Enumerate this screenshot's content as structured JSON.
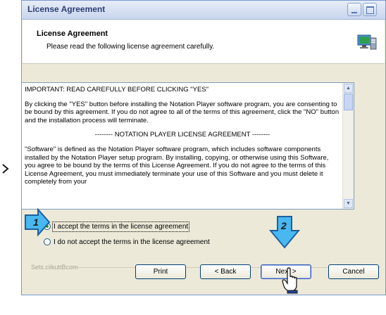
{
  "window": {
    "title": "License Agreement",
    "header_title": "License Agreement",
    "header_subtitle": "Please read the following license agreement carefully."
  },
  "license": {
    "paragraphs": [
      "IMPORTANT: READ CAREFULLY BEFORE CLICKING \"YES\"",
      "By clicking the \"YES\" button before installing the Notation Player software program, you are consenting to be bound by this agreement. If you do not agree to all of the terms of this agreement, click the \"NO\" button and the installation process will terminate.",
      "-------- NOTATION PLAYER LICENSE AGREEMENT --------",
      "\"Software\" is defined as the Notation Player software program, which includes software components installed by the Notation Player setup program. By installing, copying, or otherwise using this Software, you agree to be bound by the terms of this License Agreement.  If you do not agree to the terms of this License Agreement, you must immediately terminate your use of this Software and you must delete it completely from your"
    ]
  },
  "options": {
    "accept_label": "I accept the terms in the license agreement",
    "decline_label": "I do not accept the terms in the license agreement",
    "selected": "accept"
  },
  "footer": {
    "brand": "Sets.ciikuttBcom",
    "print_label": "Print",
    "back_label": "< Back",
    "next_label": "Next >",
    "cancel_label": "Cancel"
  },
  "callouts": {
    "step1": "1",
    "step2": "2"
  },
  "colors": {
    "callout_fill": "#49b8f0",
    "callout_stroke": "#1f5f9e",
    "dialog_bg": "#ece9d8"
  }
}
